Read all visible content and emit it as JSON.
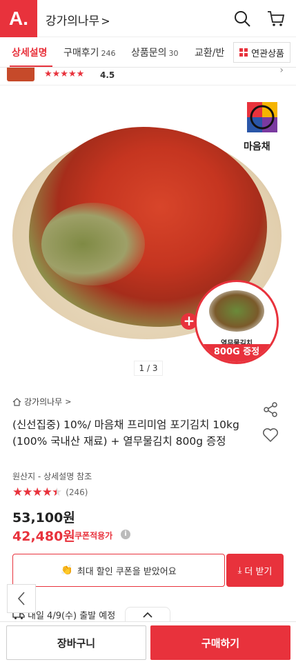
{
  "header": {
    "logo_text": "A.",
    "store_name": "강가의나무",
    "chevron": ">"
  },
  "tabs": [
    {
      "label": "상세설명",
      "count": ""
    },
    {
      "label": "구매후기",
      "count": "246"
    },
    {
      "label": "상품문의",
      "count": "30"
    },
    {
      "label": "교환/반",
      "count": ""
    }
  ],
  "related_button": {
    "label": "연관상품"
  },
  "mini_strip": {
    "stars": "★★★★★",
    "rating": "4.5",
    "chevron": "›"
  },
  "image": {
    "brand_text": "마음채",
    "side_dish_label": "열무물김치",
    "side_dish_promo": "800G 증정",
    "plus": "+",
    "page_indicator": "1 / 3"
  },
  "product": {
    "breadcrumb": "강가의나무",
    "breadcrumb_chevron": ">",
    "title": "(신선집중) 10%/ 마음채 프리미엄 포기김치 10kg (100% 국내산 재료) + 열무물김치 800g 증정",
    "origin": "원산지 - 상세설명 참조",
    "stars_filled": "★★★★",
    "stars_half": "★",
    "stars_empty": "★",
    "rating_value": 4.5,
    "review_count": "(246)",
    "price_original": "53,100원",
    "price_coupon": "42,480원",
    "coupon_applied_label": "쿠폰적용가",
    "info_icon": "i"
  },
  "coupon": {
    "clap_icon": "👏",
    "label": "최대 할인 쿠폰을 받았어요",
    "more_icon": "⤓",
    "more_label": "더 받기"
  },
  "shipping": {
    "text": "내일 4/9(수) 출발 예정"
  },
  "bottom_bar": {
    "cart_label": "장바구니",
    "buy_label": "구매하기"
  },
  "colors": {
    "accent": "#e8323c"
  }
}
